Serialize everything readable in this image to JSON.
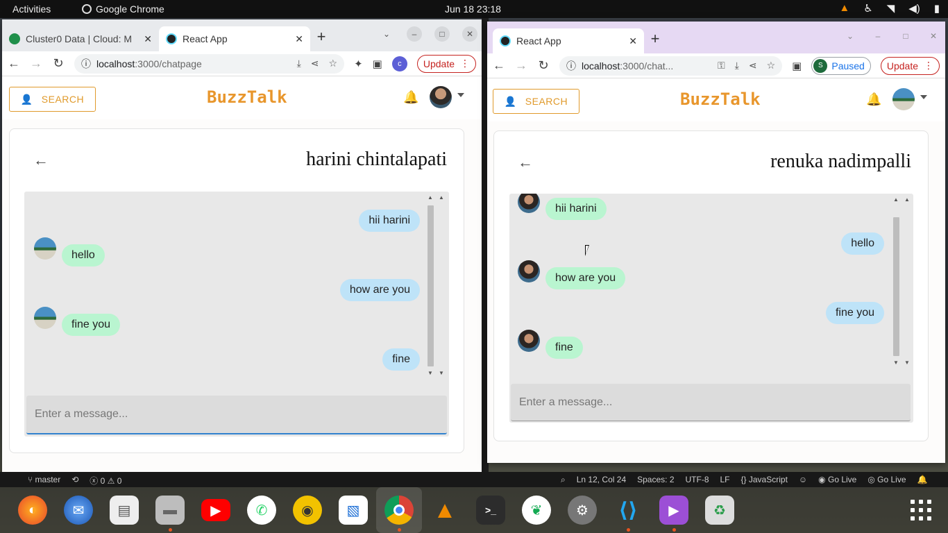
{
  "system": {
    "activities": "Activities",
    "app_name": "Google Chrome",
    "clock": "Jun 18  23:18"
  },
  "left_window": {
    "tabs": [
      {
        "label": "Cluster0 Data | Cloud: M",
        "active": false
      },
      {
        "label": "React App",
        "active": true
      }
    ],
    "url_host": "localhost",
    "url_path": ":3000/chatpage",
    "profile_initial": "c",
    "update_label": "Update",
    "app": {
      "search_label": "SEARCH",
      "brand": "BuzzTalk",
      "contact_name": "harini chintalapati",
      "messages": [
        {
          "text": "hii harini",
          "direction": "out"
        },
        {
          "text": "hello",
          "direction": "in",
          "avatar": "beach"
        },
        {
          "text": "how are you",
          "direction": "out"
        },
        {
          "text": "fine you",
          "direction": "in",
          "avatar": "beach"
        },
        {
          "text": "fine",
          "direction": "out"
        }
      ],
      "input_placeholder": "Enter a message..."
    }
  },
  "right_window": {
    "tabs": [
      {
        "label": "React App",
        "active": true
      }
    ],
    "url_host": "localhost",
    "url_path": ":3000/chat...",
    "paused_label": "Paused",
    "profile_initial": "S",
    "update_label": "Update",
    "app": {
      "search_label": "SEARCH",
      "brand": "BuzzTalk",
      "contact_name": "renuka nadimpalli",
      "messages": [
        {
          "text": "hii harini",
          "direction": "in",
          "avatar": "man"
        },
        {
          "text": "hello",
          "direction": "out"
        },
        {
          "text": "how are you",
          "direction": "in",
          "avatar": "man"
        },
        {
          "text": "fine you",
          "direction": "out"
        },
        {
          "text": "fine",
          "direction": "in",
          "avatar": "man"
        }
      ],
      "input_placeholder": "Enter a message..."
    }
  },
  "statusbar": {
    "branch": "master",
    "problems": "0 ⚠ 0",
    "position": "Ln 12, Col 24",
    "spaces": "Spaces: 2",
    "encoding": "UTF-8",
    "eol": "LF",
    "language": "JavaScript",
    "golive1": "Go Live",
    "golive2": "Go Live"
  },
  "dock": {
    "apps": [
      "firefox-icon",
      "thunderbird-icon",
      "document-viewer-icon",
      "files-icon",
      "youtube-icon",
      "whatsapp-icon",
      "rhythmbox-icon",
      "writer-icon",
      "chrome-icon",
      "vlc-icon",
      "terminal-icon",
      "mongodb-compass-icon",
      "settings-icon",
      "vscode-icon",
      "video-icon",
      "trash-icon"
    ],
    "active_app": "chrome-icon"
  }
}
